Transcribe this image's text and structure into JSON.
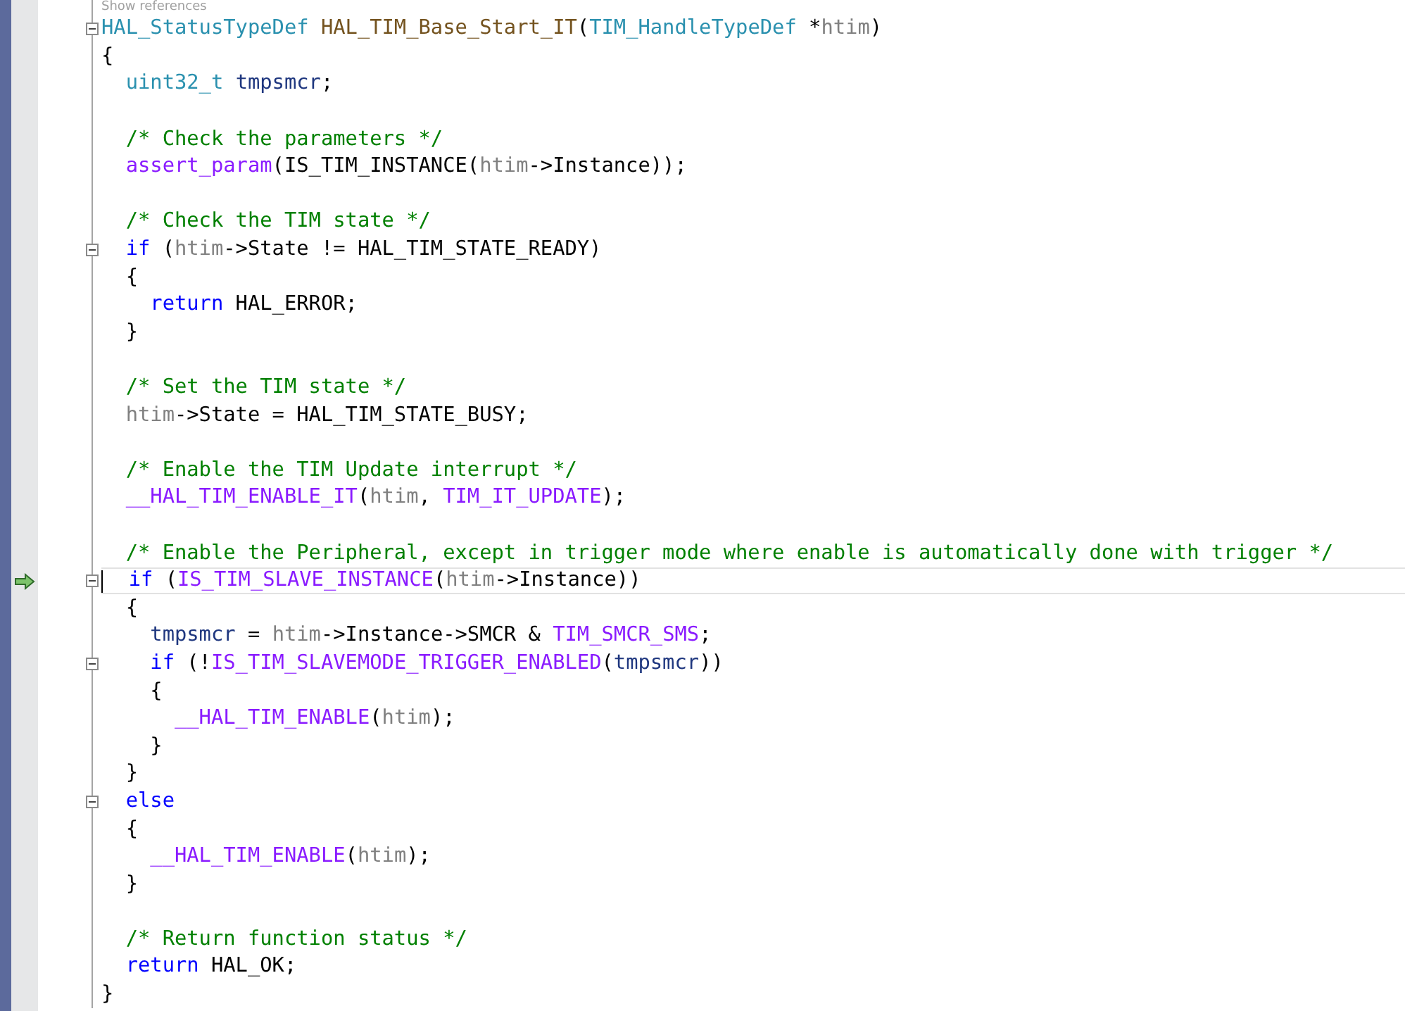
{
  "codelens": "Show references",
  "lines": [
    {
      "fold": true,
      "current": false,
      "tokens": [
        {
          "kind": "type",
          "text": "HAL_StatusTypeDef "
        },
        {
          "kind": "fn",
          "text": "HAL_TIM_Base_Start_IT"
        },
        {
          "kind": "plain",
          "text": "("
        },
        {
          "kind": "type",
          "text": "TIM_HandleTypeDef"
        },
        {
          "kind": "plain",
          "text": " *"
        },
        {
          "kind": "param",
          "text": "htim"
        },
        {
          "kind": "plain",
          "text": ")"
        }
      ]
    },
    {
      "fold": false,
      "current": false,
      "tokens": [
        {
          "kind": "plain",
          "text": "{"
        }
      ]
    },
    {
      "fold": false,
      "current": false,
      "tokens": [
        {
          "kind": "type",
          "text": "  uint32_t "
        },
        {
          "kind": "local",
          "text": "tmpsmcr"
        },
        {
          "kind": "plain",
          "text": ";"
        }
      ]
    },
    {
      "fold": false,
      "current": false
    },
    {
      "fold": false,
      "current": false,
      "tokens": [
        {
          "kind": "comment",
          "text": "  /* Check the parameters */"
        }
      ]
    },
    {
      "fold": false,
      "current": false,
      "tokens": [
        {
          "kind": "macro",
          "text": "  assert_param"
        },
        {
          "kind": "plain",
          "text": "(IS_TIM_INSTANCE("
        },
        {
          "kind": "param",
          "text": "htim"
        },
        {
          "kind": "plain",
          "text": "->Instance));"
        }
      ]
    },
    {
      "fold": false,
      "current": false
    },
    {
      "fold": false,
      "current": false,
      "tokens": [
        {
          "kind": "comment",
          "text": "  /* Check the TIM state */"
        }
      ]
    },
    {
      "fold": true,
      "current": false,
      "tokens": [
        {
          "kind": "kw",
          "text": "  if"
        },
        {
          "kind": "plain",
          "text": " ("
        },
        {
          "kind": "param",
          "text": "htim"
        },
        {
          "kind": "plain",
          "text": "->State != HAL_TIM_STATE_READY)"
        }
      ]
    },
    {
      "fold": false,
      "current": false,
      "tokens": [
        {
          "kind": "plain",
          "text": "  {"
        }
      ]
    },
    {
      "fold": false,
      "current": false,
      "tokens": [
        {
          "kind": "kw",
          "text": "    return"
        },
        {
          "kind": "plain",
          "text": " HAL_ERROR;"
        }
      ]
    },
    {
      "fold": false,
      "current": false,
      "tokens": [
        {
          "kind": "plain",
          "text": "  }"
        }
      ]
    },
    {
      "fold": false,
      "current": false
    },
    {
      "fold": false,
      "current": false,
      "tokens": [
        {
          "kind": "comment",
          "text": "  /* Set the TIM state */"
        }
      ]
    },
    {
      "fold": false,
      "current": false,
      "tokens": [
        {
          "kind": "param",
          "text": "  htim"
        },
        {
          "kind": "plain",
          "text": "->State = HAL_TIM_STATE_BUSY;"
        }
      ]
    },
    {
      "fold": false,
      "current": false
    },
    {
      "fold": false,
      "current": false,
      "tokens": [
        {
          "kind": "comment",
          "text": "  /* Enable the TIM Update interrupt */"
        }
      ]
    },
    {
      "fold": false,
      "current": false,
      "tokens": [
        {
          "kind": "macro",
          "text": "  __HAL_TIM_ENABLE_IT"
        },
        {
          "kind": "plain",
          "text": "("
        },
        {
          "kind": "param",
          "text": "htim"
        },
        {
          "kind": "plain",
          "text": ", "
        },
        {
          "kind": "macro",
          "text": "TIM_IT_UPDATE"
        },
        {
          "kind": "plain",
          "text": ");"
        }
      ]
    },
    {
      "fold": false,
      "current": false
    },
    {
      "fold": false,
      "current": false,
      "tokens": [
        {
          "kind": "comment",
          "text": "  /* Enable the Peripheral, except in trigger mode where enable is automatically done with trigger */"
        }
      ]
    },
    {
      "fold": true,
      "current": true,
      "tokens": [
        {
          "kind": "kw",
          "text": "  if"
        },
        {
          "kind": "plain",
          "text": " ("
        },
        {
          "kind": "macro",
          "text": "IS_TIM_SLAVE_INSTANCE"
        },
        {
          "kind": "plain",
          "text": "("
        },
        {
          "kind": "param",
          "text": "htim"
        },
        {
          "kind": "plain",
          "text": "->Instance))"
        }
      ]
    },
    {
      "fold": false,
      "current": false,
      "tokens": [
        {
          "kind": "plain",
          "text": "  {"
        }
      ]
    },
    {
      "fold": false,
      "current": false,
      "tokens": [
        {
          "kind": "local",
          "text": "    tmpsmcr"
        },
        {
          "kind": "plain",
          "text": " = "
        },
        {
          "kind": "param",
          "text": "htim"
        },
        {
          "kind": "plain",
          "text": "->Instance->SMCR & "
        },
        {
          "kind": "macro",
          "text": "TIM_SMCR_SMS"
        },
        {
          "kind": "plain",
          "text": ";"
        }
      ]
    },
    {
      "fold": true,
      "current": false,
      "tokens": [
        {
          "kind": "kw",
          "text": "    if"
        },
        {
          "kind": "plain",
          "text": " (!"
        },
        {
          "kind": "macro",
          "text": "IS_TIM_SLAVEMODE_TRIGGER_ENABLED"
        },
        {
          "kind": "plain",
          "text": "("
        },
        {
          "kind": "local",
          "text": "tmpsmcr"
        },
        {
          "kind": "plain",
          "text": "))"
        }
      ]
    },
    {
      "fold": false,
      "current": false,
      "tokens": [
        {
          "kind": "plain",
          "text": "    {"
        }
      ]
    },
    {
      "fold": false,
      "current": false,
      "tokens": [
        {
          "kind": "macro",
          "text": "      __HAL_TIM_ENABLE"
        },
        {
          "kind": "plain",
          "text": "("
        },
        {
          "kind": "param",
          "text": "htim"
        },
        {
          "kind": "plain",
          "text": ");"
        }
      ]
    },
    {
      "fold": false,
      "current": false,
      "tokens": [
        {
          "kind": "plain",
          "text": "    }"
        }
      ]
    },
    {
      "fold": false,
      "current": false,
      "tokens": [
        {
          "kind": "plain",
          "text": "  }"
        }
      ]
    },
    {
      "fold": true,
      "current": false,
      "tokens": [
        {
          "kind": "kw",
          "text": "  else"
        }
      ]
    },
    {
      "fold": false,
      "current": false,
      "tokens": [
        {
          "kind": "plain",
          "text": "  {"
        }
      ]
    },
    {
      "fold": false,
      "current": false,
      "tokens": [
        {
          "kind": "macro",
          "text": "    __HAL_TIM_ENABLE"
        },
        {
          "kind": "plain",
          "text": "("
        },
        {
          "kind": "param",
          "text": "htim"
        },
        {
          "kind": "plain",
          "text": ");"
        }
      ]
    },
    {
      "fold": false,
      "current": false,
      "tokens": [
        {
          "kind": "plain",
          "text": "  }"
        }
      ]
    },
    {
      "fold": false,
      "current": false
    },
    {
      "fold": false,
      "current": false,
      "tokens": [
        {
          "kind": "comment",
          "text": "  /* Return function status */"
        }
      ]
    },
    {
      "fold": false,
      "current": false,
      "tokens": [
        {
          "kind": "kw",
          "text": "  return"
        },
        {
          "kind": "plain",
          "text": " HAL_OK;"
        }
      ]
    },
    {
      "fold": false,
      "current": false,
      "tokens": [
        {
          "kind": "plain",
          "text": "}"
        }
      ]
    }
  ]
}
